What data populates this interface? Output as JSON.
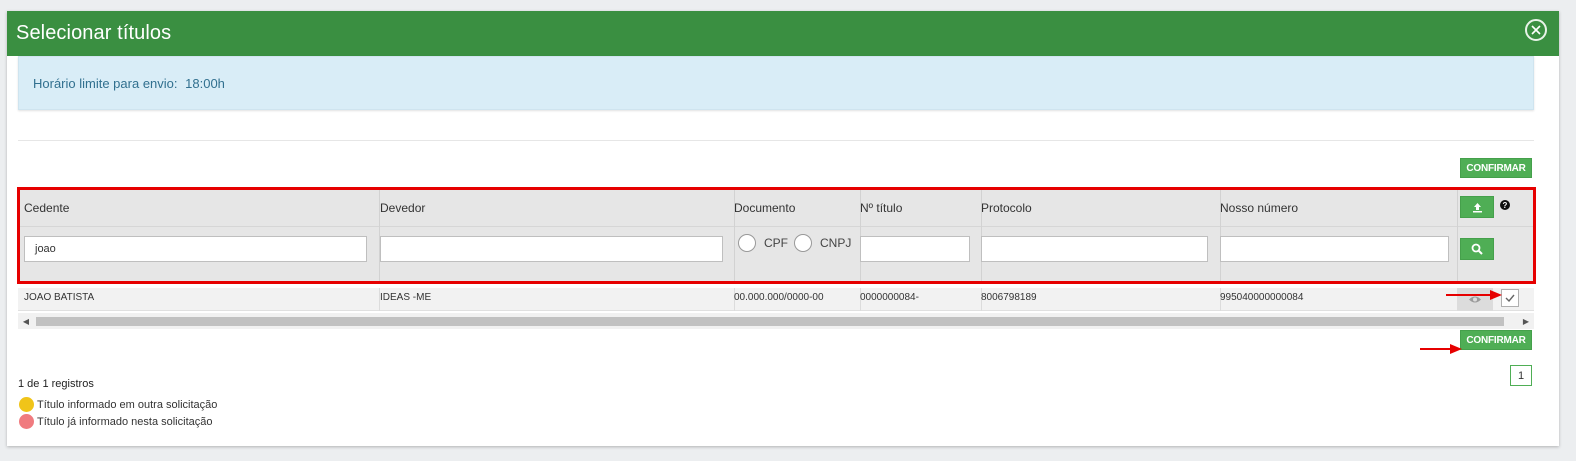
{
  "modal": {
    "title": "Selecionar títulos"
  },
  "info": {
    "label": "Horário limite para envio:",
    "value": "18:00h"
  },
  "actions": {
    "confirm_label": "CONFIRMAR"
  },
  "table": {
    "columns": [
      "Cedente",
      "Devedor",
      "Documento",
      "Nº título",
      "Protocolo",
      "Nosso número"
    ],
    "filters": {
      "cedente_value": "joao",
      "devedor_value": "",
      "numero_value": "",
      "protocolo_value": "",
      "nosso_numero_value": "",
      "doc_options": [
        "CPF",
        "CNPJ"
      ]
    },
    "rows": [
      {
        "cedente": "JOAO BATISTA",
        "devedor": "IDEAS -ME",
        "documento": "00.000.000/0000-00",
        "numero": "0000000084-",
        "protocolo": "8006798189",
        "nosso_numero": "995040000000084",
        "checked": true
      }
    ]
  },
  "footer": {
    "count_text": "1 de 1 registros",
    "legend": [
      {
        "label": "Título informado em outra solicitação",
        "color": "#f0c419"
      },
      {
        "label": "Título já informado nesta solicitação",
        "color": "#f07b7f"
      }
    ],
    "page": "1"
  },
  "colors": {
    "header_green": "#3a8f41",
    "button_green": "#4fae55",
    "info_bg": "#d9edf7",
    "highlight_red": "#e60000"
  },
  "icons": {
    "close": "close-icon",
    "upload": "upload-icon",
    "help": "help-icon",
    "search": "search-icon",
    "view": "eye-icon",
    "check": "check-icon"
  }
}
